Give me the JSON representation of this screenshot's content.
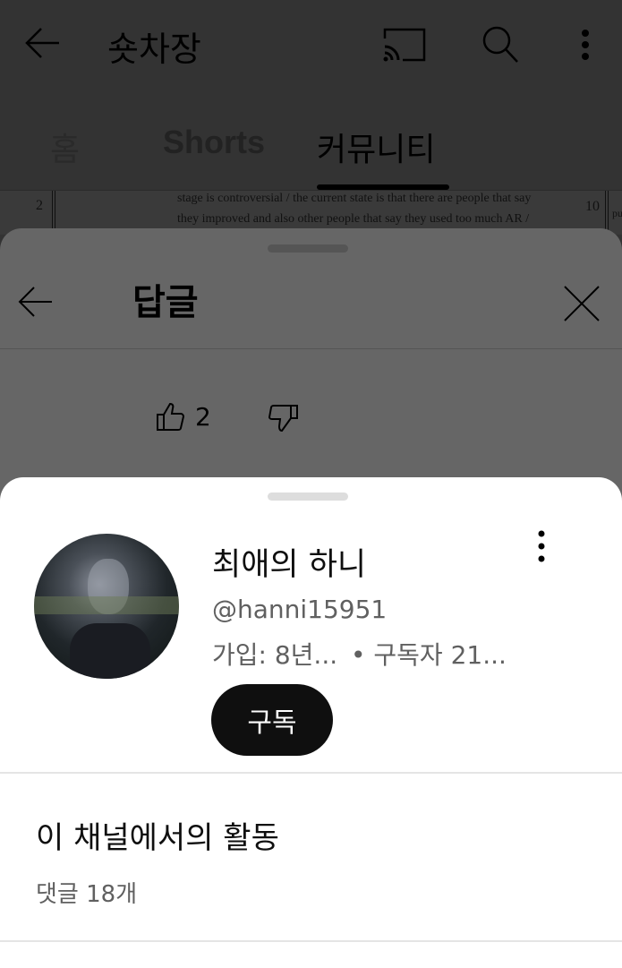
{
  "header": {
    "title": "숏차장",
    "icons": [
      "back-arrow-icon",
      "cast-icon",
      "search-icon",
      "more-vert-icon"
    ]
  },
  "tabs": [
    {
      "label": "홈"
    },
    {
      "label": "Shorts"
    },
    {
      "label": "커뮤니티",
      "active": true
    }
  ],
  "background_doc": {
    "line1": "stage is controversial / the current state is that there are people that say",
    "line2": "they improved and also other people that say they used too much AR /",
    "left_num": "2",
    "right_num": "10",
    "right_text": "pu"
  },
  "replies_sheet": {
    "title": "답글",
    "like_count": "2"
  },
  "profile_card": {
    "name": "최애의 하니",
    "handle": "@hanni15951",
    "joined": "가입: 8년...",
    "subscribers": "• 구독자 21...",
    "subscribe_label": "구독",
    "activity_title": "이 채널에서의 활동",
    "comment_count": "댓글 18개"
  },
  "colors": {
    "scrim": "#333333",
    "sheet": "#666666",
    "card": "#ffffff",
    "button": "#0f0f0f"
  }
}
